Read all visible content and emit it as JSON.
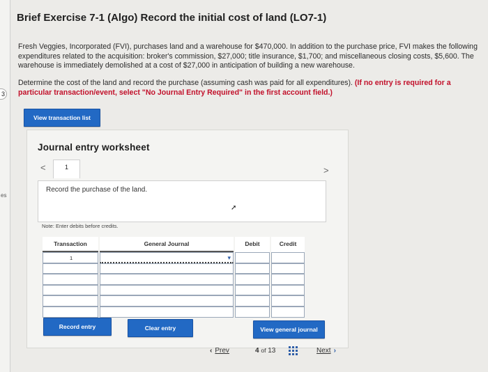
{
  "gutter": {
    "tag": "3",
    "text": "es"
  },
  "header": {
    "title": "Brief Exercise 7-1 (Algo) Record the initial cost of land (LO7-1)"
  },
  "problem": {
    "paragraph1": "Fresh Veggies, Incorporated (FVI), purchases land and a warehouse for $470,000. In addition to the purchase price, FVI makes the following expenditures related to the acquisition: broker's commission, $27,000; title insurance, $1,700; and miscellaneous closing costs, $5,600. The warehouse is immediately demolished at a cost of $27,000 in anticipation of building a new warehouse.",
    "paragraph2_plain": "Determine the cost of the land and record the purchase (assuming cash was paid for all expenditures). ",
    "paragraph2_bold": "(If no entry is required for a particular transaction/event, select \"No Journal Entry Required\" in the first account field.)"
  },
  "buttons": {
    "view_transaction_list": "View transaction list",
    "record_entry": "Record entry",
    "clear_entry": "Clear entry",
    "view_general_journal": "View general journal"
  },
  "worksheet": {
    "title": "Journal entry worksheet",
    "tab": "1",
    "prev_chevron": "<",
    "next_chevron": ">",
    "instruction": "Record the purchase of the land.",
    "note": "Note: Enter debits before credits."
  },
  "table": {
    "headers": [
      "Transaction",
      "General Journal",
      "Debit",
      "Credit"
    ],
    "rows": [
      {
        "transaction": "1",
        "account": "",
        "debit": "",
        "credit": ""
      },
      {
        "transaction": "",
        "account": "",
        "debit": "",
        "credit": ""
      },
      {
        "transaction": "",
        "account": "",
        "debit": "",
        "credit": ""
      },
      {
        "transaction": "",
        "account": "",
        "debit": "",
        "credit": ""
      },
      {
        "transaction": "",
        "account": "",
        "debit": "",
        "credit": ""
      },
      {
        "transaction": "",
        "account": "",
        "debit": "",
        "credit": ""
      }
    ]
  },
  "pagination": {
    "prev": "Prev",
    "current": "4",
    "of_label": "of",
    "total": "13",
    "next": "Next"
  },
  "colors": {
    "button_blue": "#2269c4",
    "instruction_red": "#c2112b",
    "cell_border": "#9aa7b8"
  }
}
